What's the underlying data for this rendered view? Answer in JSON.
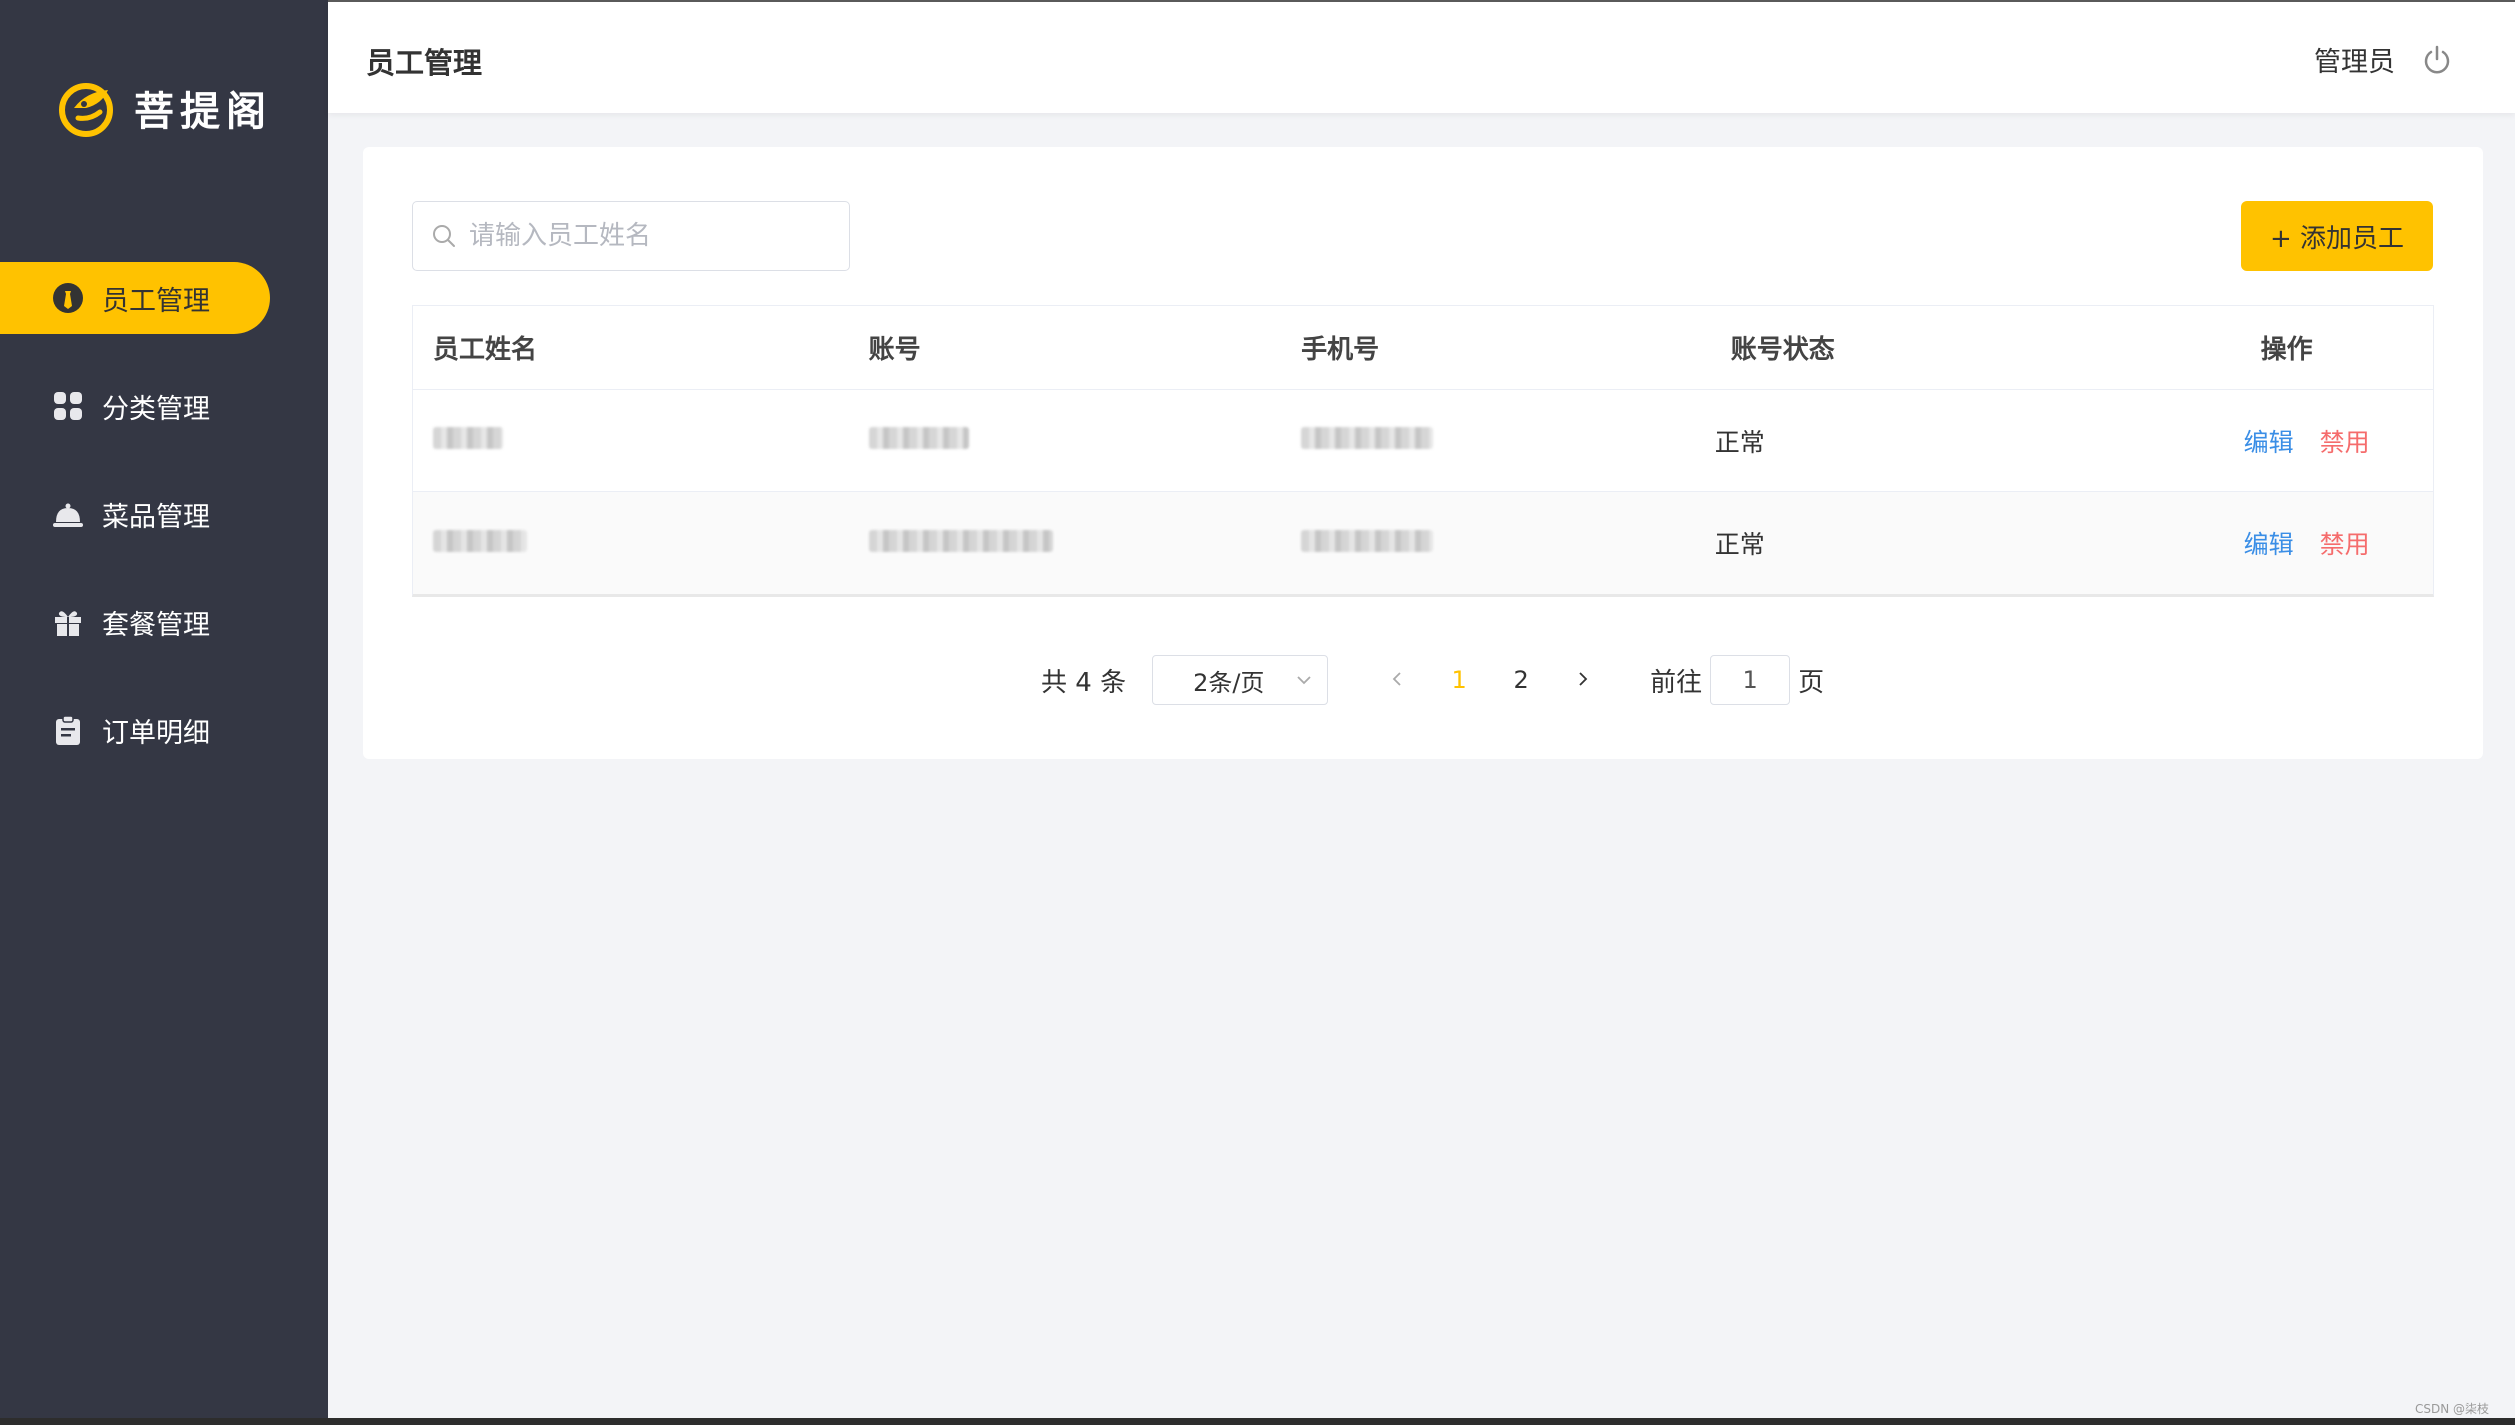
{
  "brand": {
    "name": "菩提阁"
  },
  "sidebar": {
    "items": [
      {
        "label": "员工管理",
        "icon": "employee-icon",
        "active": true
      },
      {
        "label": "分类管理",
        "icon": "grid-icon",
        "active": false
      },
      {
        "label": "菜品管理",
        "icon": "dish-cloche-icon",
        "active": false
      },
      {
        "label": "套餐管理",
        "icon": "gift-icon",
        "active": false
      },
      {
        "label": "订单明细",
        "icon": "clipboard-icon",
        "active": false
      }
    ]
  },
  "header": {
    "title": "员工管理",
    "user": "管理员",
    "logout_icon": "power-icon"
  },
  "toolbar": {
    "search_placeholder": "请输入员工姓名",
    "add_label": "+ 添加员工"
  },
  "table": {
    "columns": [
      "员工姓名",
      "账号",
      "手机号",
      "账号状态",
      "操作"
    ],
    "rows": [
      {
        "status": "正常",
        "edit": "编辑",
        "disable": "禁用"
      },
      {
        "status": "正常",
        "edit": "编辑",
        "disable": "禁用"
      }
    ]
  },
  "pagination": {
    "total": "共 4 条",
    "page_size": "2条/页",
    "pages": [
      "1",
      "2"
    ],
    "current_page": 1,
    "goto_label": "前往",
    "goto_value": "1",
    "page_unit": "页"
  },
  "colors": {
    "accent": "#ffc200",
    "sidebar_bg": "#343744",
    "link": "#3a8ee6",
    "danger": "#f56c6c"
  },
  "watermark": "CSDN @柒枝"
}
